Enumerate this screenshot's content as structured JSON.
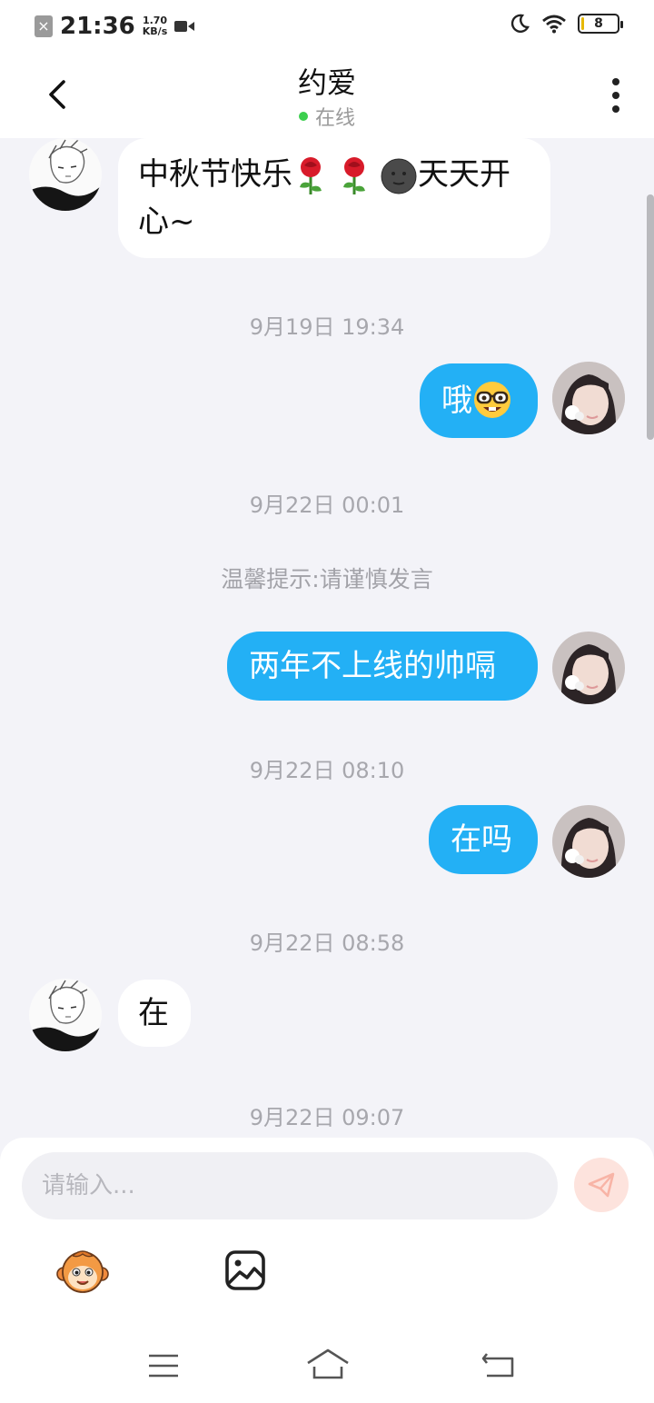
{
  "status_bar": {
    "time": "21:36",
    "net_speed_value": "1.70",
    "net_speed_unit": "KB/s",
    "battery_level": "8"
  },
  "header": {
    "title": "约爱",
    "status": "在线"
  },
  "messages": [
    {
      "side": "in",
      "text": "中秋节快乐",
      "text_after": "天天开",
      "text_line2": "心~"
    },
    {
      "timestamp": "9月19日 19:34"
    },
    {
      "side": "out",
      "text": "哦"
    },
    {
      "timestamp": "9月22日 00:01"
    },
    {
      "notice": "温馨提示:请谨慎发言"
    },
    {
      "side": "out",
      "text": "两年不上线的帅嗝"
    },
    {
      "timestamp": "9月22日 08:10"
    },
    {
      "side": "out",
      "text": "在吗"
    },
    {
      "timestamp": "9月22日 08:58"
    },
    {
      "side": "in",
      "text": "在"
    },
    {
      "timestamp": "9月22日 09:07"
    }
  ],
  "input": {
    "placeholder": "请输入..."
  },
  "colors": {
    "outgoing_bubble": "#23b0f5",
    "incoming_bubble": "#ffffff",
    "background": "#f3f3f8",
    "online_dot": "#3ccf4e"
  },
  "icons": {
    "send": "paper-plane-icon",
    "emoji": "monkey-emoji-icon",
    "image": "image-icon"
  }
}
